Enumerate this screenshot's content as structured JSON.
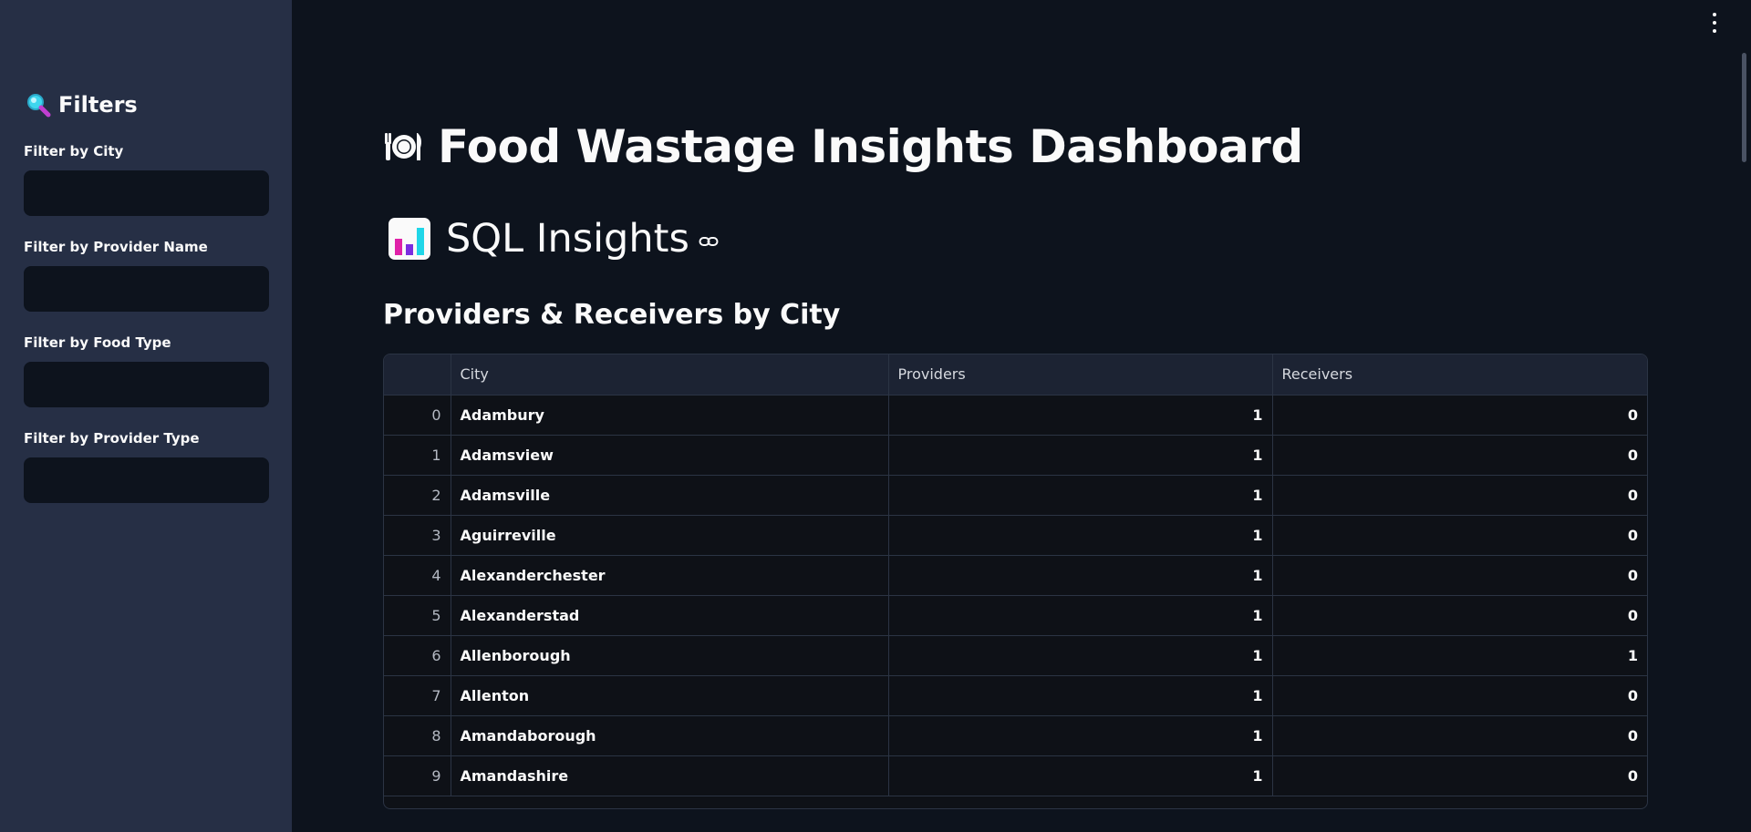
{
  "sidebar": {
    "title": "Filters",
    "filters": [
      {
        "label": "Filter by City",
        "value": ""
      },
      {
        "label": "Filter by Provider Name",
        "value": ""
      },
      {
        "label": "Filter by Food Type",
        "value": ""
      },
      {
        "label": "Filter by Provider Type",
        "value": ""
      }
    ]
  },
  "main": {
    "title": "Food Wastage Insights Dashboard",
    "section_title": "SQL Insights",
    "subsection_title": "Providers & Receivers by City",
    "table": {
      "columns": [
        "",
        "City",
        "Providers",
        "Receivers"
      ],
      "rows": [
        {
          "index": "0",
          "city": "Adambury",
          "providers": "1",
          "receivers": "0"
        },
        {
          "index": "1",
          "city": "Adamsview",
          "providers": "1",
          "receivers": "0"
        },
        {
          "index": "2",
          "city": "Adamsville",
          "providers": "1",
          "receivers": "0"
        },
        {
          "index": "3",
          "city": "Aguirreville",
          "providers": "1",
          "receivers": "0"
        },
        {
          "index": "4",
          "city": "Alexanderchester",
          "providers": "1",
          "receivers": "0"
        },
        {
          "index": "5",
          "city": "Alexanderstad",
          "providers": "1",
          "receivers": "0"
        },
        {
          "index": "6",
          "city": "Allenborough",
          "providers": "1",
          "receivers": "1"
        },
        {
          "index": "7",
          "city": "Allenton",
          "providers": "1",
          "receivers": "0"
        },
        {
          "index": "8",
          "city": "Amandaborough",
          "providers": "1",
          "receivers": "0"
        },
        {
          "index": "9",
          "city": "Amandashire",
          "providers": "1",
          "receivers": "0"
        }
      ]
    }
  },
  "icons": {
    "sidebar_title": "magnifier-icon",
    "page_title": "plate-cutlery-icon",
    "section_title": "bar-chart-icon",
    "anchor": "link-icon",
    "menu": "kebab-menu-icon"
  },
  "colors": {
    "background": "#0d131d",
    "sidebar": "#262f45",
    "table_header": "#1c2333",
    "border": "#2b3444",
    "text": "#fafafa"
  }
}
